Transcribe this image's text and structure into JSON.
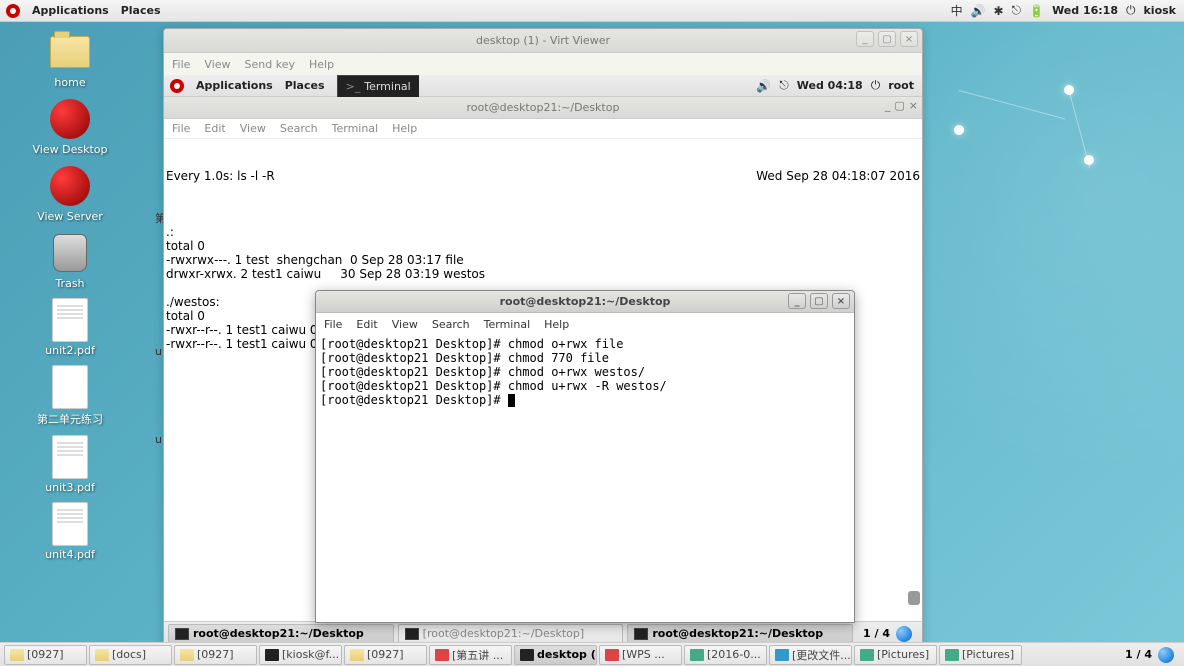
{
  "host_panel": {
    "applications": "Applications",
    "places": "Places",
    "ime": "中",
    "day_time": "Wed 16:18",
    "user": "kiosk"
  },
  "desktop": {
    "home": "home",
    "view_desktop": "View Desktop",
    "view_server": "View Server",
    "trash": "Trash",
    "unit2": "unit2.pdf",
    "file2": "第二单元练习",
    "unit3": "unit3.pdf",
    "unit4": "unit4.pdf"
  },
  "virt": {
    "title": "desktop (1) - Virt Viewer",
    "menu": {
      "file": "File",
      "view": "View",
      "sendkey": "Send key",
      "help": "Help"
    }
  },
  "inner_panel": {
    "applications": "Applications",
    "places": "Places",
    "terminal_btn": "Terminal",
    "day_time": "Wed 04:18",
    "user": "root"
  },
  "watch_term": {
    "title": "root@desktop21:~/Desktop",
    "menu": {
      "file": "File",
      "edit": "Edit",
      "view": "View",
      "search": "Search",
      "terminal": "Terminal",
      "help": "Help"
    },
    "watch_cmd": "Every 1.0s: ls -l -R",
    "watch_time": "Wed Sep 28 04:18:07 2016",
    "lines": [
      ".:",
      "total 0",
      "-rwxrwx---. 1 test  shengchan  0 Sep 28 03:17 file",
      "drwxr-xrwx. 2 test1 caiwu     30 Sep 28 03:19 westos",
      "",
      "./westos:",
      "total 0",
      "-rwxr--r--. 1 test1 caiwu 0 Sep 28 03:19 test1",
      "-rwxr--r--. 1 test1 caiwu 0 Sep 28 03:19 test2"
    ]
  },
  "fg_term": {
    "title": "root@desktop21:~/Desktop",
    "menu": {
      "file": "File",
      "edit": "Edit",
      "view": "View",
      "search": "Search",
      "terminal": "Terminal",
      "help": "Help"
    },
    "prompt": "[root@desktop21 Desktop]# ",
    "cmds": [
      "chmod o+rwx file",
      "chmod 770 file",
      "chmod o+rwx westos/",
      "chmod u+rwx -R westos/"
    ]
  },
  "inner_taskbar": {
    "t1": "root@desktop21:~/Desktop",
    "t2": "[root@desktop21:~/Desktop]",
    "t3": "root@desktop21:~/Desktop",
    "workspace": "1 / 4"
  },
  "host_taskbar": {
    "tasks": [
      "[0927]",
      "[docs]",
      "[0927]",
      "[kiosk@f...",
      "[0927]",
      "[第五讲 ...",
      "desktop (...",
      "[WPS ...",
      "[2016-0...",
      "[更改文件...",
      "[Pictures]",
      "[Pictures]"
    ],
    "workspace": "1 / 4"
  },
  "clips": {
    "a": "第",
    "b": "u",
    "c": "u"
  }
}
